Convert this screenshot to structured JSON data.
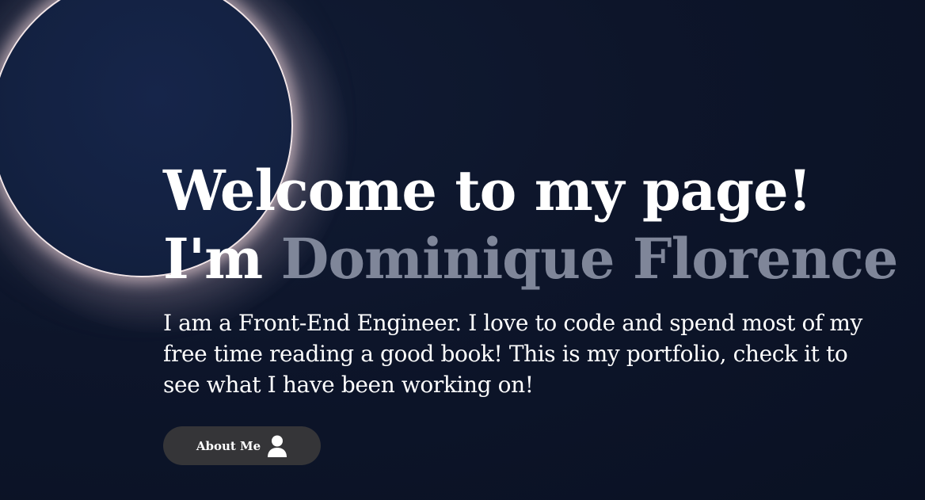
{
  "hero": {
    "line1": "Welcome to my page!",
    "line2_prefix": "I'm ",
    "name": "Dominique Florence",
    "bio": "I am a Front-End Engineer. I love to code and spend most of my free time reading a good book! This is my portfolio, check it to see what I have been working on!"
  },
  "cta": {
    "label": "About Me",
    "icon": "user-icon"
  },
  "colors": {
    "background": "#0d152a",
    "name_accent": "#7f8699",
    "button": "#353538",
    "eclipse_ring": "#f3e6e8"
  }
}
